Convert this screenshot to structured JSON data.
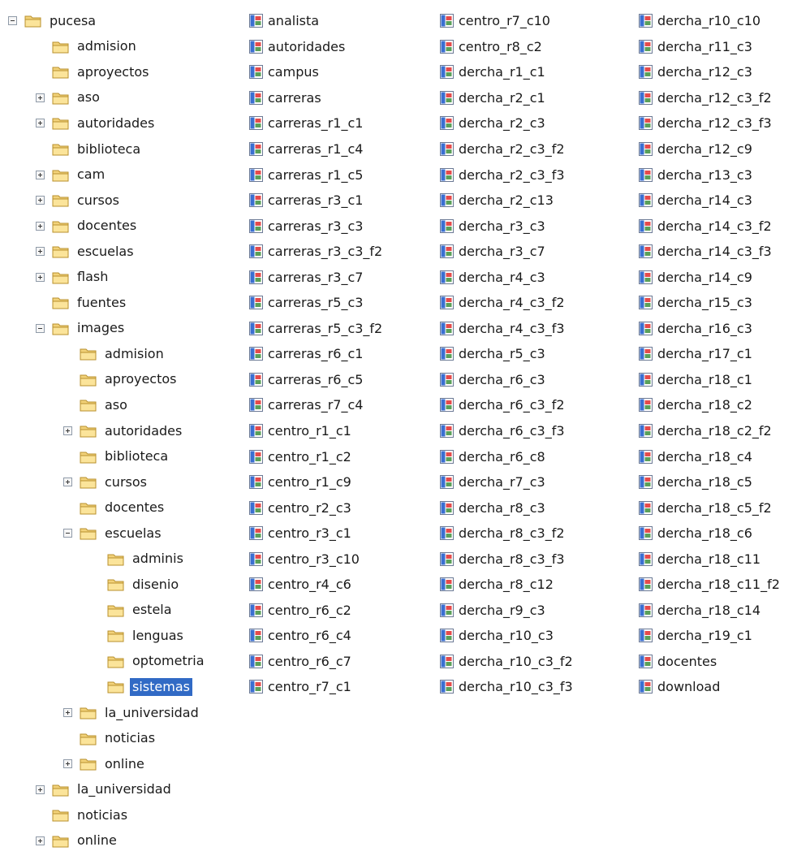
{
  "icons": {
    "folder": "folder-icon",
    "file": "image-file-icon",
    "expand": "expand-plus-icon",
    "collapse": "collapse-minus-icon"
  },
  "colors": {
    "selection": "#316ac5",
    "folder": "#f2d27a",
    "file_icon_blue": "#3b6fd1"
  },
  "tree": [
    {
      "label": "pucesa",
      "level": 0,
      "toggle": "minus"
    },
    {
      "label": "admision",
      "level": 1,
      "toggle": "none"
    },
    {
      "label": "aproyectos",
      "level": 1,
      "toggle": "none"
    },
    {
      "label": "aso",
      "level": 1,
      "toggle": "plus"
    },
    {
      "label": "autoridades",
      "level": 1,
      "toggle": "plus"
    },
    {
      "label": "biblioteca",
      "level": 1,
      "toggle": "none"
    },
    {
      "label": "cam",
      "level": 1,
      "toggle": "plus"
    },
    {
      "label": "cursos",
      "level": 1,
      "toggle": "plus"
    },
    {
      "label": "docentes",
      "level": 1,
      "toggle": "plus"
    },
    {
      "label": "escuelas",
      "level": 1,
      "toggle": "plus"
    },
    {
      "label": "flash",
      "level": 1,
      "toggle": "plus"
    },
    {
      "label": "fuentes",
      "level": 1,
      "toggle": "none"
    },
    {
      "label": "images",
      "level": 1,
      "toggle": "minus"
    },
    {
      "label": "admision",
      "level": 2,
      "toggle": "none"
    },
    {
      "label": "aproyectos",
      "level": 2,
      "toggle": "none"
    },
    {
      "label": "aso",
      "level": 2,
      "toggle": "none"
    },
    {
      "label": "autoridades",
      "level": 2,
      "toggle": "plus"
    },
    {
      "label": "biblioteca",
      "level": 2,
      "toggle": "none"
    },
    {
      "label": "cursos",
      "level": 2,
      "toggle": "plus"
    },
    {
      "label": "docentes",
      "level": 2,
      "toggle": "none"
    },
    {
      "label": "escuelas",
      "level": 2,
      "toggle": "minus"
    },
    {
      "label": "adminis",
      "level": 3,
      "toggle": "none"
    },
    {
      "label": "disenio",
      "level": 3,
      "toggle": "none"
    },
    {
      "label": "estela",
      "level": 3,
      "toggle": "none"
    },
    {
      "label": "lenguas",
      "level": 3,
      "toggle": "none"
    },
    {
      "label": "optometria",
      "level": 3,
      "toggle": "none"
    },
    {
      "label": "sistemas",
      "level": 3,
      "toggle": "none",
      "selected": true
    },
    {
      "label": "la_universidad",
      "level": 2,
      "toggle": "plus"
    },
    {
      "label": "noticias",
      "level": 2,
      "toggle": "none"
    },
    {
      "label": "online",
      "level": 2,
      "toggle": "plus"
    },
    {
      "label": "la_universidad",
      "level": 1,
      "toggle": "plus"
    },
    {
      "label": "noticias",
      "level": 1,
      "toggle": "none"
    },
    {
      "label": "online",
      "level": 1,
      "toggle": "plus"
    }
  ],
  "files": [
    [
      "analista",
      "autoridades",
      "campus",
      "carreras",
      "carreras_r1_c1",
      "carreras_r1_c4",
      "carreras_r1_c5",
      "carreras_r3_c1",
      "carreras_r3_c3",
      "carreras_r3_c3_f2",
      "carreras_r3_c7",
      "carreras_r5_c3",
      "carreras_r5_c3_f2",
      "carreras_r6_c1",
      "carreras_r6_c5",
      "carreras_r7_c4",
      "centro_r1_c1",
      "centro_r1_c2",
      "centro_r1_c9",
      "centro_r2_c3",
      "centro_r3_c1",
      "centro_r3_c10",
      "centro_r4_c6",
      "centro_r6_c2",
      "centro_r6_c4",
      "centro_r6_c7",
      "centro_r7_c1"
    ],
    [
      "centro_r7_c10",
      "centro_r8_c2",
      "dercha_r1_c1",
      "dercha_r2_c1",
      "dercha_r2_c3",
      "dercha_r2_c3_f2",
      "dercha_r2_c3_f3",
      "dercha_r2_c13",
      "dercha_r3_c3",
      "dercha_r3_c7",
      "dercha_r4_c3",
      "dercha_r4_c3_f2",
      "dercha_r4_c3_f3",
      "dercha_r5_c3",
      "dercha_r6_c3",
      "dercha_r6_c3_f2",
      "dercha_r6_c3_f3",
      "dercha_r6_c8",
      "dercha_r7_c3",
      "dercha_r8_c3",
      "dercha_r8_c3_f2",
      "dercha_r8_c3_f3",
      "dercha_r8_c12",
      "dercha_r9_c3",
      "dercha_r10_c3",
      "dercha_r10_c3_f2",
      "dercha_r10_c3_f3"
    ],
    [
      "dercha_r10_c10",
      "dercha_r11_c3",
      "dercha_r12_c3",
      "dercha_r12_c3_f2",
      "dercha_r12_c3_f3",
      "dercha_r12_c9",
      "dercha_r13_c3",
      "dercha_r14_c3",
      "dercha_r14_c3_f2",
      "dercha_r14_c3_f3",
      "dercha_r14_c9",
      "dercha_r15_c3",
      "dercha_r16_c3",
      "dercha_r17_c1",
      "dercha_r18_c1",
      "dercha_r18_c2",
      "dercha_r18_c2_f2",
      "dercha_r18_c4",
      "dercha_r18_c5",
      "dercha_r18_c5_f2",
      "dercha_r18_c6",
      "dercha_r18_c11",
      "dercha_r18_c11_f2",
      "dercha_r18_c14",
      "dercha_r19_c1",
      "docentes",
      "download"
    ]
  ]
}
